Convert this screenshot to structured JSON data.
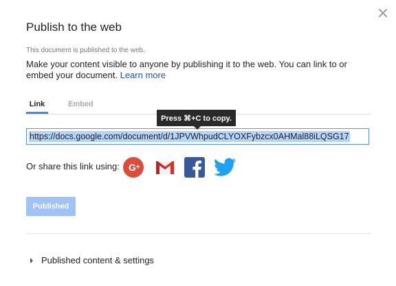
{
  "dialog": {
    "title": "Publish to the web",
    "status": "This document is published to the web.",
    "description": "Make your content visible to anyone by publishing it to the web. You can link to or embed your document.",
    "learn_more": "Learn more",
    "close_icon": "close-icon"
  },
  "tabs": [
    {
      "label": "Link",
      "active": true
    },
    {
      "label": "Embed",
      "active": false
    }
  ],
  "tooltip": "Press ⌘+C to copy.",
  "link": {
    "url": "https://docs.google.com/document/d/1JPVWhpudCLYOXFybzcx0AHMal88iLQSG17"
  },
  "share": {
    "label": "Or share this link using:",
    "services": [
      "google-plus-icon",
      "gmail-icon",
      "facebook-icon",
      "twitter-icon"
    ]
  },
  "publish_button": "Published",
  "settings_section": "Published content & settings",
  "colors": {
    "accent": "#4285f4",
    "link": "#1155cc",
    "google_plus": "#dd4b39",
    "gmail_red": "#d93025",
    "facebook": "#3b5998",
    "twitter": "#1da1f2",
    "publish_disabled": "#9fc3f7"
  }
}
